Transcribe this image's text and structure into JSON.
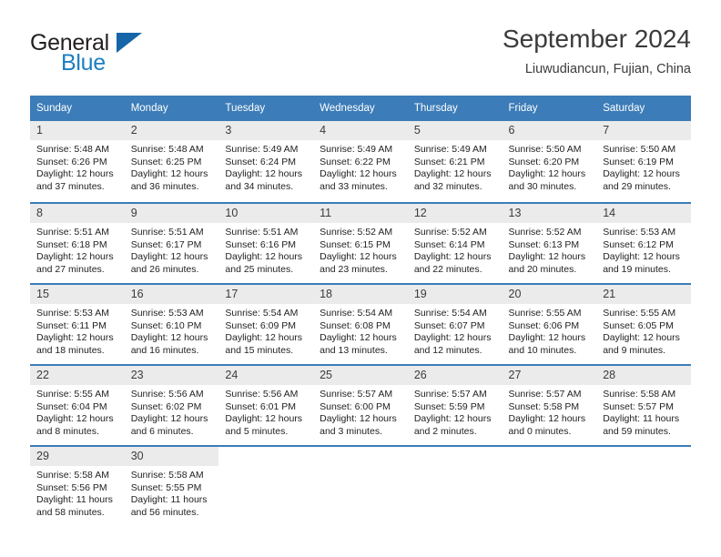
{
  "brand": {
    "line1": "General",
    "line2": "Blue",
    "triangle_icon": "triangle-icon",
    "color_dark": "#231f20",
    "color_blue": "#1b7ec2"
  },
  "header": {
    "title": "September 2024",
    "subtitle": "Liuwudiancun, Fujian, China"
  },
  "theme": {
    "header_blue": "#3c7cb8",
    "daynum_gray": "#ebebeb"
  },
  "weekdays": [
    "Sunday",
    "Monday",
    "Tuesday",
    "Wednesday",
    "Thursday",
    "Friday",
    "Saturday"
  ],
  "weeks": [
    [
      {
        "day": "1",
        "sunrise": "Sunrise: 5:48 AM",
        "sunset": "Sunset: 6:26 PM",
        "daylight": "Daylight: 12 hours and 37 minutes."
      },
      {
        "day": "2",
        "sunrise": "Sunrise: 5:48 AM",
        "sunset": "Sunset: 6:25 PM",
        "daylight": "Daylight: 12 hours and 36 minutes."
      },
      {
        "day": "3",
        "sunrise": "Sunrise: 5:49 AM",
        "sunset": "Sunset: 6:24 PM",
        "daylight": "Daylight: 12 hours and 34 minutes."
      },
      {
        "day": "4",
        "sunrise": "Sunrise: 5:49 AM",
        "sunset": "Sunset: 6:22 PM",
        "daylight": "Daylight: 12 hours and 33 minutes."
      },
      {
        "day": "5",
        "sunrise": "Sunrise: 5:49 AM",
        "sunset": "Sunset: 6:21 PM",
        "daylight": "Daylight: 12 hours and 32 minutes."
      },
      {
        "day": "6",
        "sunrise": "Sunrise: 5:50 AM",
        "sunset": "Sunset: 6:20 PM",
        "daylight": "Daylight: 12 hours and 30 minutes."
      },
      {
        "day": "7",
        "sunrise": "Sunrise: 5:50 AM",
        "sunset": "Sunset: 6:19 PM",
        "daylight": "Daylight: 12 hours and 29 minutes."
      }
    ],
    [
      {
        "day": "8",
        "sunrise": "Sunrise: 5:51 AM",
        "sunset": "Sunset: 6:18 PM",
        "daylight": "Daylight: 12 hours and 27 minutes."
      },
      {
        "day": "9",
        "sunrise": "Sunrise: 5:51 AM",
        "sunset": "Sunset: 6:17 PM",
        "daylight": "Daylight: 12 hours and 26 minutes."
      },
      {
        "day": "10",
        "sunrise": "Sunrise: 5:51 AM",
        "sunset": "Sunset: 6:16 PM",
        "daylight": "Daylight: 12 hours and 25 minutes."
      },
      {
        "day": "11",
        "sunrise": "Sunrise: 5:52 AM",
        "sunset": "Sunset: 6:15 PM",
        "daylight": "Daylight: 12 hours and 23 minutes."
      },
      {
        "day": "12",
        "sunrise": "Sunrise: 5:52 AM",
        "sunset": "Sunset: 6:14 PM",
        "daylight": "Daylight: 12 hours and 22 minutes."
      },
      {
        "day": "13",
        "sunrise": "Sunrise: 5:52 AM",
        "sunset": "Sunset: 6:13 PM",
        "daylight": "Daylight: 12 hours and 20 minutes."
      },
      {
        "day": "14",
        "sunrise": "Sunrise: 5:53 AM",
        "sunset": "Sunset: 6:12 PM",
        "daylight": "Daylight: 12 hours and 19 minutes."
      }
    ],
    [
      {
        "day": "15",
        "sunrise": "Sunrise: 5:53 AM",
        "sunset": "Sunset: 6:11 PM",
        "daylight": "Daylight: 12 hours and 18 minutes."
      },
      {
        "day": "16",
        "sunrise": "Sunrise: 5:53 AM",
        "sunset": "Sunset: 6:10 PM",
        "daylight": "Daylight: 12 hours and 16 minutes."
      },
      {
        "day": "17",
        "sunrise": "Sunrise: 5:54 AM",
        "sunset": "Sunset: 6:09 PM",
        "daylight": "Daylight: 12 hours and 15 minutes."
      },
      {
        "day": "18",
        "sunrise": "Sunrise: 5:54 AM",
        "sunset": "Sunset: 6:08 PM",
        "daylight": "Daylight: 12 hours and 13 minutes."
      },
      {
        "day": "19",
        "sunrise": "Sunrise: 5:54 AM",
        "sunset": "Sunset: 6:07 PM",
        "daylight": "Daylight: 12 hours and 12 minutes."
      },
      {
        "day": "20",
        "sunrise": "Sunrise: 5:55 AM",
        "sunset": "Sunset: 6:06 PM",
        "daylight": "Daylight: 12 hours and 10 minutes."
      },
      {
        "day": "21",
        "sunrise": "Sunrise: 5:55 AM",
        "sunset": "Sunset: 6:05 PM",
        "daylight": "Daylight: 12 hours and 9 minutes."
      }
    ],
    [
      {
        "day": "22",
        "sunrise": "Sunrise: 5:55 AM",
        "sunset": "Sunset: 6:04 PM",
        "daylight": "Daylight: 12 hours and 8 minutes."
      },
      {
        "day": "23",
        "sunrise": "Sunrise: 5:56 AM",
        "sunset": "Sunset: 6:02 PM",
        "daylight": "Daylight: 12 hours and 6 minutes."
      },
      {
        "day": "24",
        "sunrise": "Sunrise: 5:56 AM",
        "sunset": "Sunset: 6:01 PM",
        "daylight": "Daylight: 12 hours and 5 minutes."
      },
      {
        "day": "25",
        "sunrise": "Sunrise: 5:57 AM",
        "sunset": "Sunset: 6:00 PM",
        "daylight": "Daylight: 12 hours and 3 minutes."
      },
      {
        "day": "26",
        "sunrise": "Sunrise: 5:57 AM",
        "sunset": "Sunset: 5:59 PM",
        "daylight": "Daylight: 12 hours and 2 minutes."
      },
      {
        "day": "27",
        "sunrise": "Sunrise: 5:57 AM",
        "sunset": "Sunset: 5:58 PM",
        "daylight": "Daylight: 12 hours and 0 minutes."
      },
      {
        "day": "28",
        "sunrise": "Sunrise: 5:58 AM",
        "sunset": "Sunset: 5:57 PM",
        "daylight": "Daylight: 11 hours and 59 minutes."
      }
    ],
    [
      {
        "day": "29",
        "sunrise": "Sunrise: 5:58 AM",
        "sunset": "Sunset: 5:56 PM",
        "daylight": "Daylight: 11 hours and 58 minutes."
      },
      {
        "day": "30",
        "sunrise": "Sunrise: 5:58 AM",
        "sunset": "Sunset: 5:55 PM",
        "daylight": "Daylight: 11 hours and 56 minutes."
      },
      {
        "day": "",
        "sunrise": "",
        "sunset": "",
        "daylight": ""
      },
      {
        "day": "",
        "sunrise": "",
        "sunset": "",
        "daylight": ""
      },
      {
        "day": "",
        "sunrise": "",
        "sunset": "",
        "daylight": ""
      },
      {
        "day": "",
        "sunrise": "",
        "sunset": "",
        "daylight": ""
      },
      {
        "day": "",
        "sunrise": "",
        "sunset": "",
        "daylight": ""
      }
    ]
  ]
}
